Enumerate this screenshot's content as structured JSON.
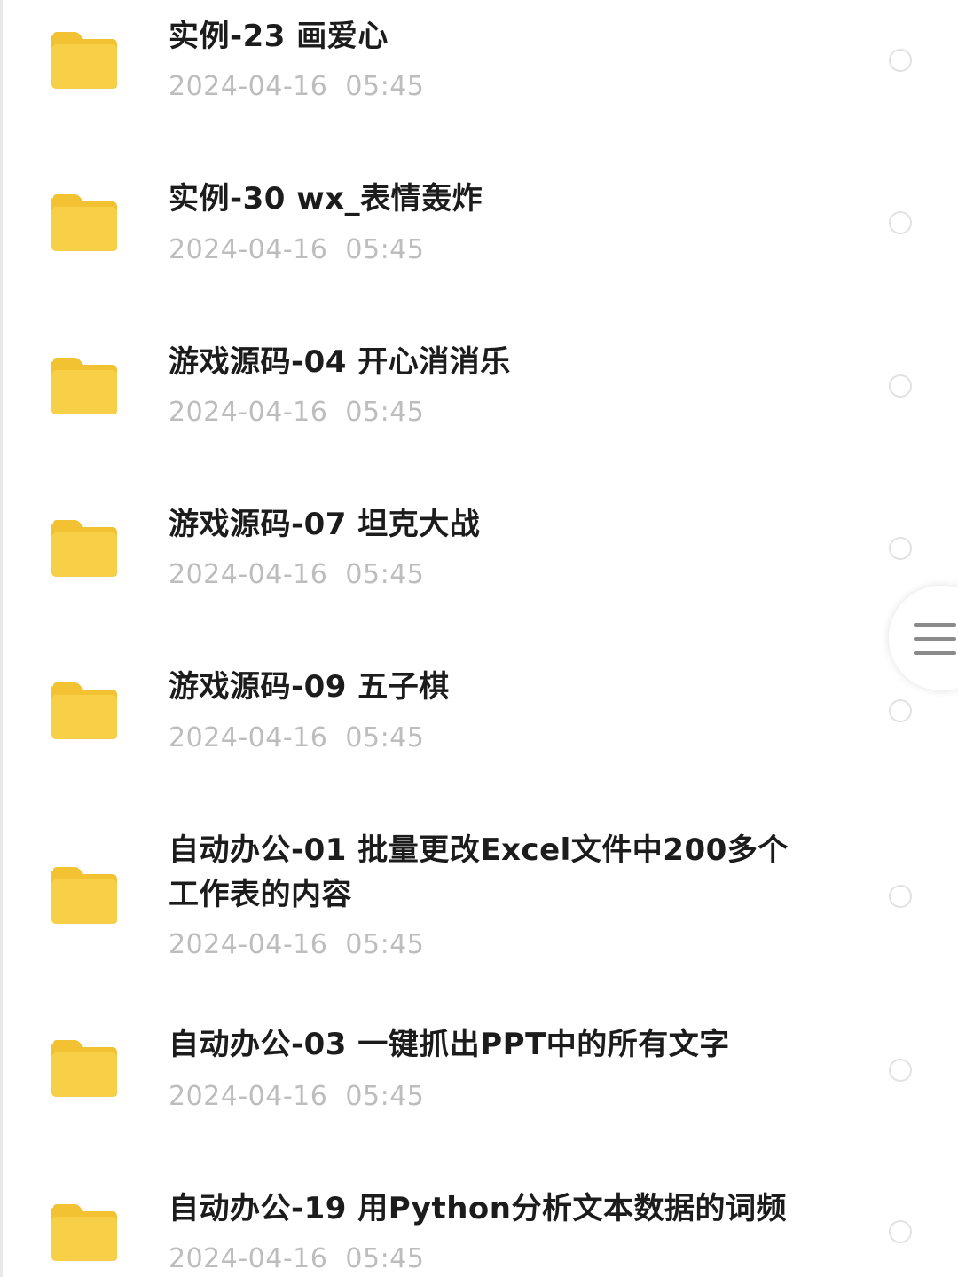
{
  "files": [
    {
      "name": "实例-23 画爱心",
      "date": "2024-04-16  05:45",
      "icon": "folder-icon"
    },
    {
      "name": "实例-30 wx_表情轰炸",
      "date": "2024-04-16  05:45",
      "icon": "folder-icon"
    },
    {
      "name": "游戏源码-04 开心消消乐",
      "date": "2024-04-16  05:45",
      "icon": "folder-icon"
    },
    {
      "name": "游戏源码-07 坦克大战",
      "date": "2024-04-16  05:45",
      "icon": "folder-icon"
    },
    {
      "name": "游戏源码-09 五子棋",
      "date": "2024-04-16  05:45",
      "icon": "folder-icon"
    },
    {
      "name_line1": "自动办公-01 批量更改Excel文件中200多个",
      "name_line2": "工作表的内容",
      "date": "2024-04-16  05:45",
      "icon": "folder-icon"
    },
    {
      "name": "自动办公-03 一键抓出PPT中的所有文字",
      "date": "2024-04-16  05:45",
      "icon": "folder-icon"
    },
    {
      "name": "自动办公-19 用Python分析文本数据的词频",
      "date": "2024-04-16  05:45",
      "icon": "folder-icon"
    }
  ],
  "side_handle": {
    "icon": "menu-icon"
  },
  "colors": {
    "folder": "#f7cf3f",
    "folder_tab": "#f2c233",
    "title_text": "#1c1c1c",
    "date_text": "#bdbdbd",
    "radio_border": "#e2e2e2"
  }
}
